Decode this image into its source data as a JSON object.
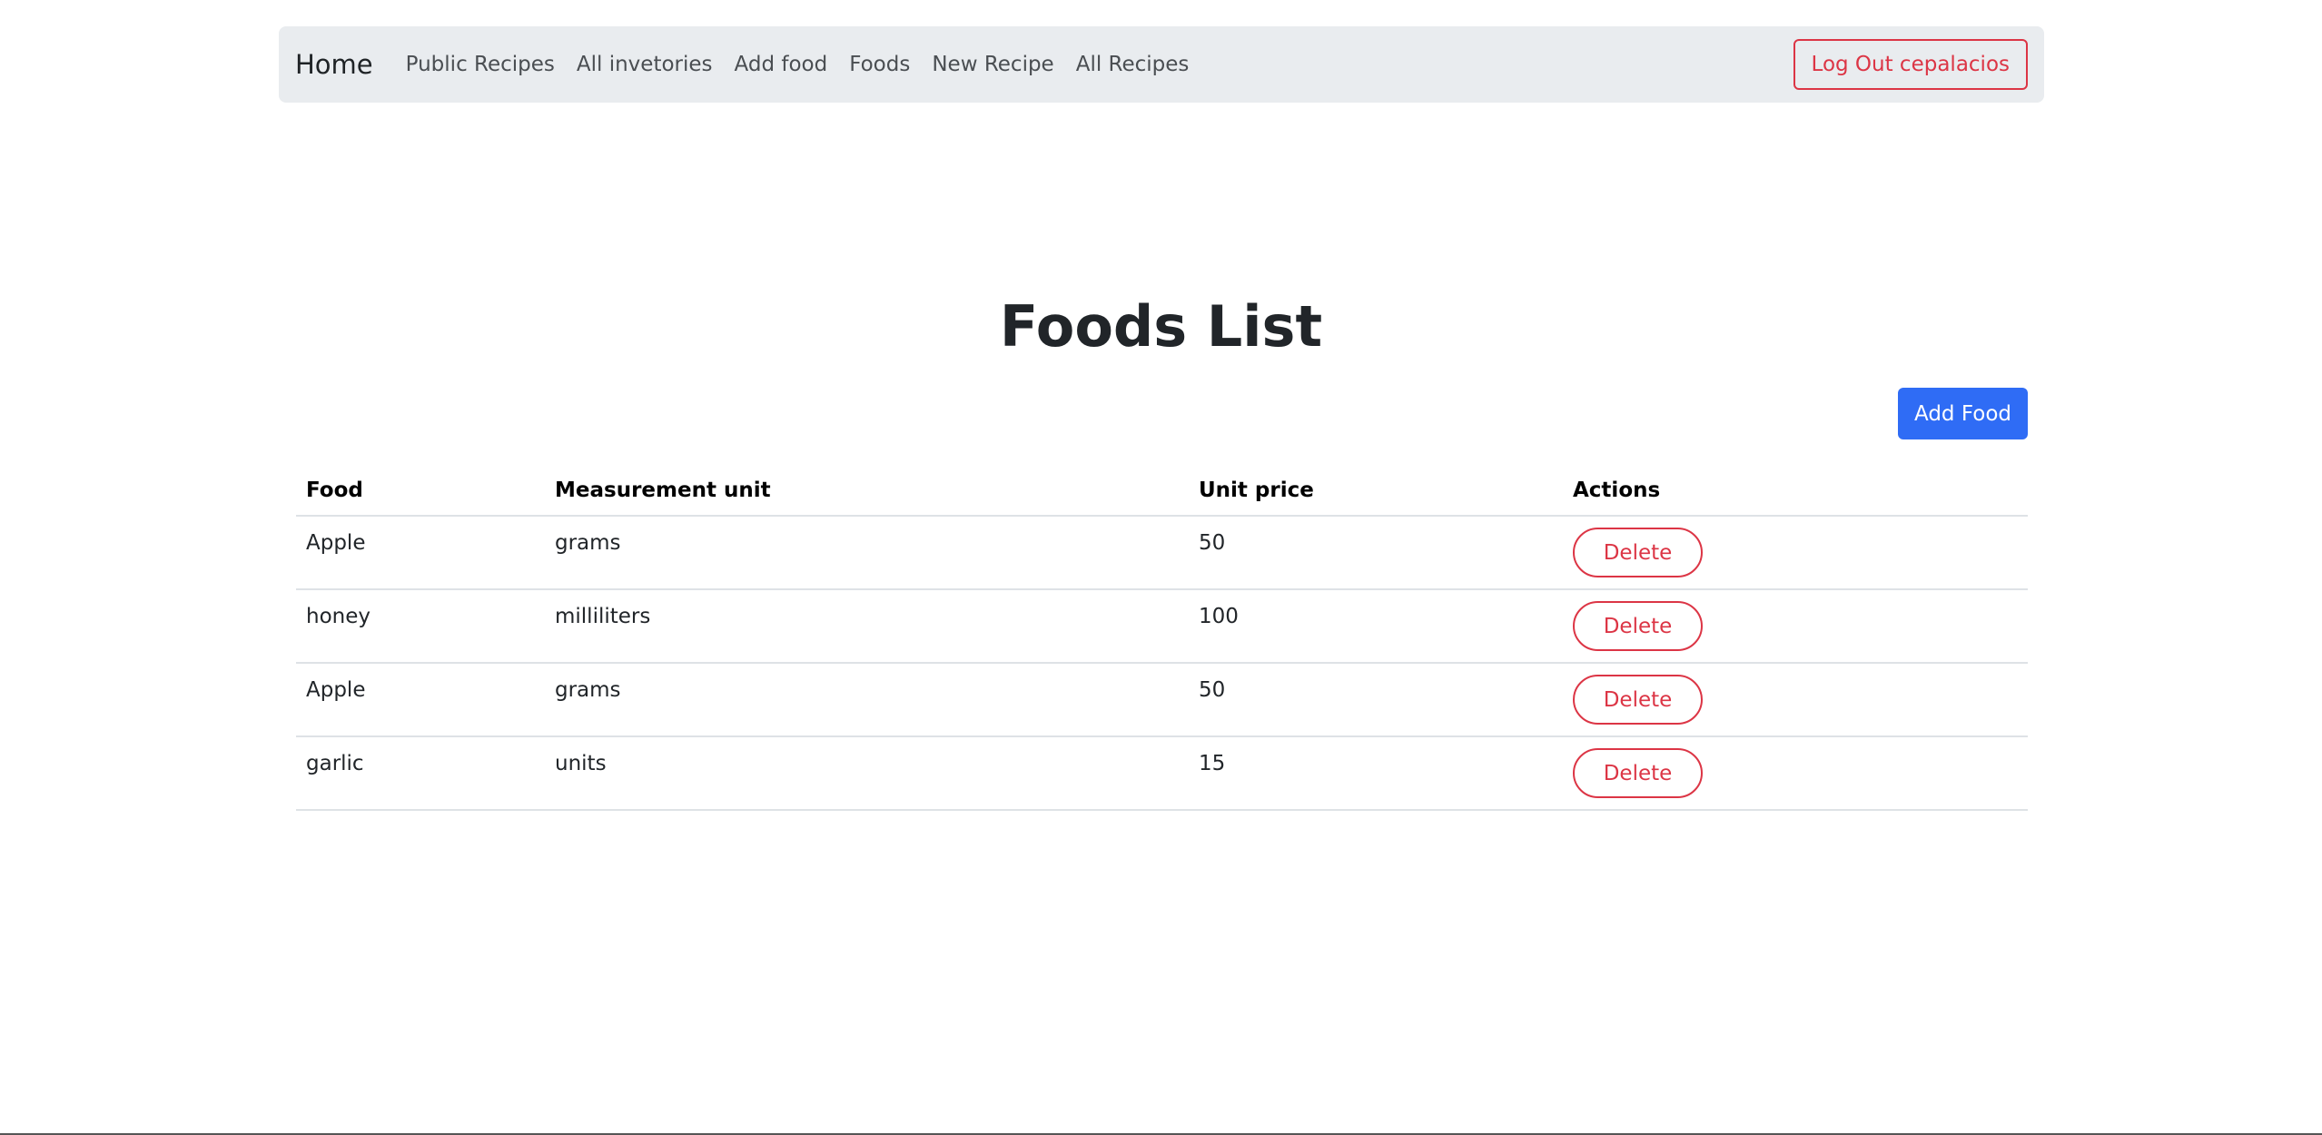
{
  "navbar": {
    "brand": "Home",
    "links": [
      "Public Recipes",
      "All invetories",
      "Add food",
      "Foods",
      "New Recipe",
      "All Recipes"
    ],
    "logout_label": "Log Out cepalacios"
  },
  "main": {
    "title": "Foods List",
    "add_food_label": "Add Food",
    "table": {
      "headers": [
        "Food",
        "Measurement unit",
        "Unit price",
        "Actions"
      ],
      "rows": [
        {
          "food": "Apple",
          "unit": "grams",
          "price": "50",
          "action": "Delete"
        },
        {
          "food": "honey",
          "unit": "milliliters",
          "price": "100",
          "action": "Delete"
        },
        {
          "food": "Apple",
          "unit": "grams",
          "price": "50",
          "action": "Delete"
        },
        {
          "food": "garlic",
          "unit": "units",
          "price": "15",
          "action": "Delete"
        }
      ]
    }
  },
  "colors": {
    "navbar_bg": "#e9ecef",
    "primary": "#2f6cf5",
    "danger": "#dc3545",
    "text": "#212529"
  }
}
